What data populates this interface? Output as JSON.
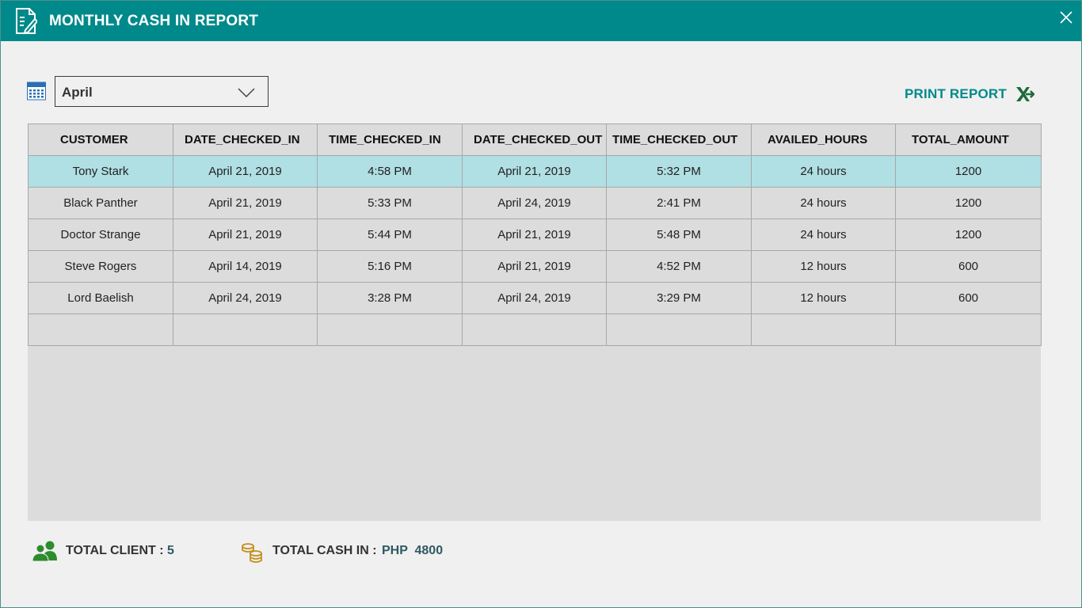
{
  "window": {
    "title": "MONTHLY CASH IN REPORT",
    "title_icon": "report-edit-icon",
    "close_icon": "close-icon",
    "accent_color": "#00898a"
  },
  "filter": {
    "calendar_icon": "calendar-icon",
    "month_selected": "April",
    "dropdown_icon": "chevron-down-icon"
  },
  "actions": {
    "print_label": "PRINT REPORT",
    "export_icon": "excel-export-icon"
  },
  "table": {
    "columns": [
      "CUSTOMER",
      "DATE_CHECKED_IN",
      "TIME_CHECKED_IN",
      "DATE_CHECKED_OUT",
      "TIME_CHECKED_OUT",
      "AVAILED_HOURS",
      "TOTAL_AMOUNT"
    ],
    "rows": [
      [
        "Tony Stark",
        "April 21, 2019",
        "4:58 PM",
        "April 21, 2019",
        "5:32 PM",
        "24 hours",
        "1200"
      ],
      [
        "Black Panther",
        "April 21, 2019",
        "5:33 PM",
        "April 24, 2019",
        "2:41 PM",
        "24 hours",
        "1200"
      ],
      [
        "Doctor Strange",
        "April 21, 2019",
        "5:44 PM",
        "April 21, 2019",
        "5:48 PM",
        "24 hours",
        "1200"
      ],
      [
        "Steve Rogers",
        "April 14, 2019",
        "5:16 PM",
        "April 21, 2019",
        "4:52 PM",
        "12 hours",
        "600"
      ],
      [
        "Lord Baelish",
        "April 24, 2019",
        "3:28 PM",
        "April 24, 2019",
        "3:29 PM",
        "12 hours",
        "600"
      ],
      [
        "",
        "",
        "",
        "",
        "",
        "",
        ""
      ]
    ],
    "selected_row_color": "#b0dfe4"
  },
  "summary": {
    "clients_icon": "users-icon",
    "total_client_label": "TOTAL CLIENT :",
    "total_client_value": "5",
    "coins_icon": "coins-icon",
    "total_cash_label": "TOTAL CASH IN :",
    "total_cash_value": "PHP  4800"
  }
}
